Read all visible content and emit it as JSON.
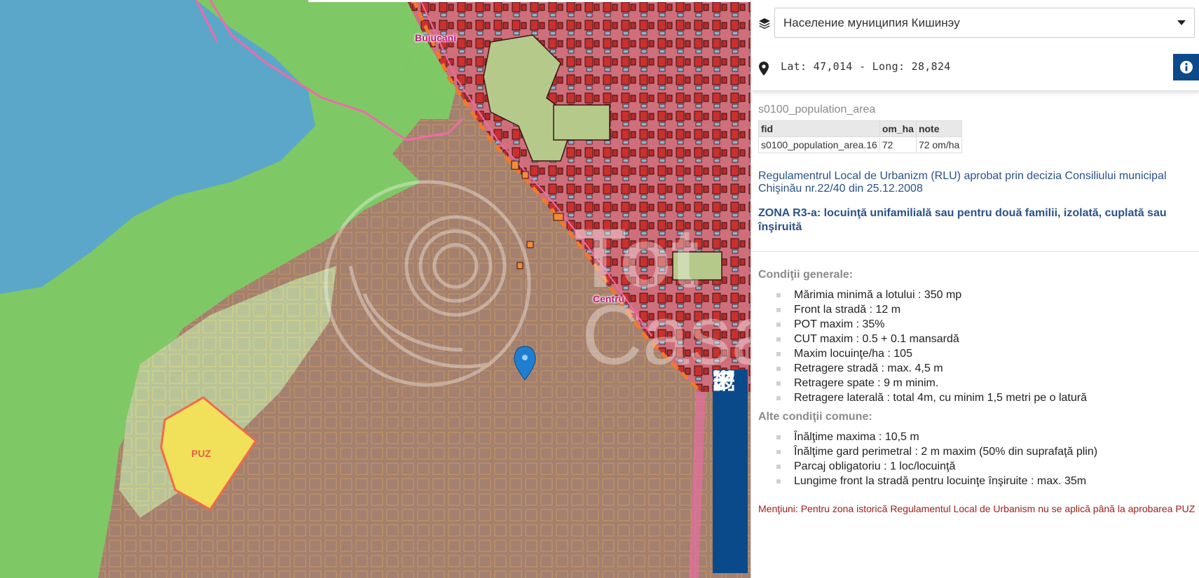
{
  "map": {
    "labels": {
      "district_buiucani": "Buiucani",
      "district_centru": "Centru",
      "puz": "PUZ"
    },
    "watermark": "Tot Casa",
    "controls": [
      "locate-icon",
      "zoom-in-icon",
      "zoom-out-icon",
      "fit-extent-icon",
      "fullscreen-icon",
      "more-icon"
    ],
    "colors": {
      "water": "#5ba7c9",
      "green_zone": "#7fc866",
      "residential": "#a07f72",
      "center": "#c96b78",
      "puz": "#f1e05a",
      "control_bg": "#0b4a8a",
      "marker": "#1e7fd0"
    }
  },
  "panel": {
    "layer_select": {
      "value": "Население муниципия Кишинэу",
      "icon": "layers-icon"
    },
    "coordinates": "Lat: 47,014 - Long: 28,824",
    "info_icon": "info-icon",
    "layer_name": "s0100_population_area",
    "table": {
      "headers": [
        "fid",
        "om_ha",
        "note"
      ],
      "rows": [
        [
          "s0100_population_area.16",
          "72",
          "72 om/ha"
        ]
      ]
    },
    "rlu_text": "Regulamentrul Local de Urbanizm (RLU) aprobat prin decizia Consiliului municipal Chişinău nr.22/40 din 25.12.2008",
    "zone_title": "ZONA R3-a: locuinţă unifamilială sau pentru două  familii,  izolată, cuplată sau înşiruită",
    "general_heading": "Condiţii generale:",
    "general_items": [
      "Mărimia minimă a lotului : 350 mp",
      "Front la stradă : 12 m",
      "POT maxim : 35%",
      "CUT maxim : 0.5 + 0.1 mansardă",
      "Maxim locuinţe/ha : 105",
      "Retragere stradă : max. 4,5 m",
      "Retragere spate : 9 m minim.",
      "Retragere laterală : total 4m, cu minim 1,5 metri pe o latură"
    ],
    "other_heading": "Alte condiţii comune:",
    "other_items": [
      "Înălţime maxima : 10,5 m",
      "Înălţime gard perimetral : 2 m maxim (50% din suprafaţă plin)",
      "Parcaj obligatoriu : 1 loc/locuinţă",
      "Lungime front la stradă pentru locuinţe înşiruite : max.  35m"
    ],
    "note": "Menţiuni: Pentru zona istorică Regulamentul Local de Urbanism nu se aplică până la aprobarea PUZ"
  }
}
